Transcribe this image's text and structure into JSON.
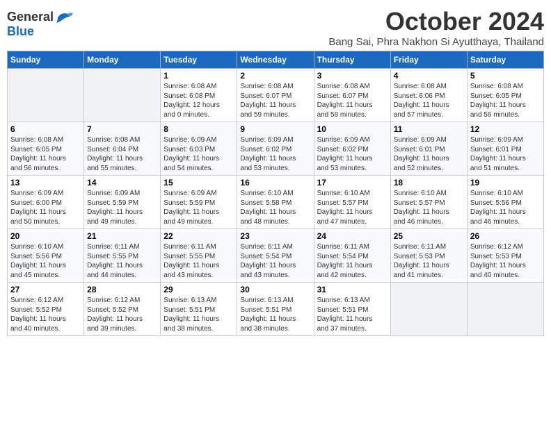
{
  "logo": {
    "general": "General",
    "blue": "Blue"
  },
  "title": "October 2024",
  "location": "Bang Sai, Phra Nakhon Si Ayutthaya, Thailand",
  "weekdays": [
    "Sunday",
    "Monday",
    "Tuesday",
    "Wednesday",
    "Thursday",
    "Friday",
    "Saturday"
  ],
  "weeks": [
    [
      {
        "day": "",
        "detail": ""
      },
      {
        "day": "",
        "detail": ""
      },
      {
        "day": "1",
        "detail": "Sunrise: 6:08 AM\nSunset: 6:08 PM\nDaylight: 12 hours\nand 0 minutes."
      },
      {
        "day": "2",
        "detail": "Sunrise: 6:08 AM\nSunset: 6:07 PM\nDaylight: 11 hours\nand 59 minutes."
      },
      {
        "day": "3",
        "detail": "Sunrise: 6:08 AM\nSunset: 6:07 PM\nDaylight: 11 hours\nand 58 minutes."
      },
      {
        "day": "4",
        "detail": "Sunrise: 6:08 AM\nSunset: 6:06 PM\nDaylight: 11 hours\nand 57 minutes."
      },
      {
        "day": "5",
        "detail": "Sunrise: 6:08 AM\nSunset: 6:05 PM\nDaylight: 11 hours\nand 56 minutes."
      }
    ],
    [
      {
        "day": "6",
        "detail": "Sunrise: 6:08 AM\nSunset: 6:05 PM\nDaylight: 11 hours\nand 56 minutes."
      },
      {
        "day": "7",
        "detail": "Sunrise: 6:08 AM\nSunset: 6:04 PM\nDaylight: 11 hours\nand 55 minutes."
      },
      {
        "day": "8",
        "detail": "Sunrise: 6:09 AM\nSunset: 6:03 PM\nDaylight: 11 hours\nand 54 minutes."
      },
      {
        "day": "9",
        "detail": "Sunrise: 6:09 AM\nSunset: 6:02 PM\nDaylight: 11 hours\nand 53 minutes."
      },
      {
        "day": "10",
        "detail": "Sunrise: 6:09 AM\nSunset: 6:02 PM\nDaylight: 11 hours\nand 53 minutes."
      },
      {
        "day": "11",
        "detail": "Sunrise: 6:09 AM\nSunset: 6:01 PM\nDaylight: 11 hours\nand 52 minutes."
      },
      {
        "day": "12",
        "detail": "Sunrise: 6:09 AM\nSunset: 6:01 PM\nDaylight: 11 hours\nand 51 minutes."
      }
    ],
    [
      {
        "day": "13",
        "detail": "Sunrise: 6:09 AM\nSunset: 6:00 PM\nDaylight: 11 hours\nand 50 minutes."
      },
      {
        "day": "14",
        "detail": "Sunrise: 6:09 AM\nSunset: 5:59 PM\nDaylight: 11 hours\nand 49 minutes."
      },
      {
        "day": "15",
        "detail": "Sunrise: 6:09 AM\nSunset: 5:59 PM\nDaylight: 11 hours\nand 49 minutes."
      },
      {
        "day": "16",
        "detail": "Sunrise: 6:10 AM\nSunset: 5:58 PM\nDaylight: 11 hours\nand 48 minutes."
      },
      {
        "day": "17",
        "detail": "Sunrise: 6:10 AM\nSunset: 5:57 PM\nDaylight: 11 hours\nand 47 minutes."
      },
      {
        "day": "18",
        "detail": "Sunrise: 6:10 AM\nSunset: 5:57 PM\nDaylight: 11 hours\nand 46 minutes."
      },
      {
        "day": "19",
        "detail": "Sunrise: 6:10 AM\nSunset: 5:56 PM\nDaylight: 11 hours\nand 46 minutes."
      }
    ],
    [
      {
        "day": "20",
        "detail": "Sunrise: 6:10 AM\nSunset: 5:56 PM\nDaylight: 11 hours\nand 45 minutes."
      },
      {
        "day": "21",
        "detail": "Sunrise: 6:11 AM\nSunset: 5:55 PM\nDaylight: 11 hours\nand 44 minutes."
      },
      {
        "day": "22",
        "detail": "Sunrise: 6:11 AM\nSunset: 5:55 PM\nDaylight: 11 hours\nand 43 minutes."
      },
      {
        "day": "23",
        "detail": "Sunrise: 6:11 AM\nSunset: 5:54 PM\nDaylight: 11 hours\nand 43 minutes."
      },
      {
        "day": "24",
        "detail": "Sunrise: 6:11 AM\nSunset: 5:54 PM\nDaylight: 11 hours\nand 42 minutes."
      },
      {
        "day": "25",
        "detail": "Sunrise: 6:11 AM\nSunset: 5:53 PM\nDaylight: 11 hours\nand 41 minutes."
      },
      {
        "day": "26",
        "detail": "Sunrise: 6:12 AM\nSunset: 5:53 PM\nDaylight: 11 hours\nand 40 minutes."
      }
    ],
    [
      {
        "day": "27",
        "detail": "Sunrise: 6:12 AM\nSunset: 5:52 PM\nDaylight: 11 hours\nand 40 minutes."
      },
      {
        "day": "28",
        "detail": "Sunrise: 6:12 AM\nSunset: 5:52 PM\nDaylight: 11 hours\nand 39 minutes."
      },
      {
        "day": "29",
        "detail": "Sunrise: 6:13 AM\nSunset: 5:51 PM\nDaylight: 11 hours\nand 38 minutes."
      },
      {
        "day": "30",
        "detail": "Sunrise: 6:13 AM\nSunset: 5:51 PM\nDaylight: 11 hours\nand 38 minutes."
      },
      {
        "day": "31",
        "detail": "Sunrise: 6:13 AM\nSunset: 5:51 PM\nDaylight: 11 hours\nand 37 minutes."
      },
      {
        "day": "",
        "detail": ""
      },
      {
        "day": "",
        "detail": ""
      }
    ]
  ]
}
